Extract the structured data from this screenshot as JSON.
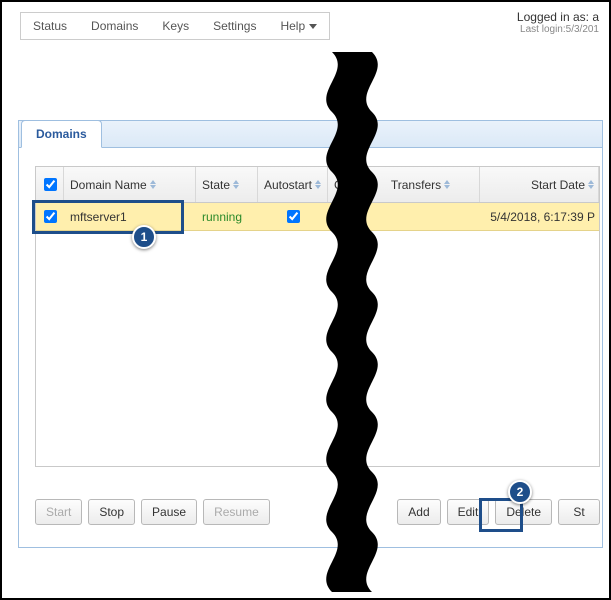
{
  "menu": {
    "status": "Status",
    "domains": "Domains",
    "keys": "Keys",
    "settings": "Settings",
    "help": "Help"
  },
  "login": {
    "logged_in": "Logged in as: a",
    "last": "Last login:5/3/201"
  },
  "tab": {
    "domains": "Domains"
  },
  "columns": {
    "name": "Domain Name",
    "state": "State",
    "autostart": "Autostart",
    "cut": "C",
    "transfers": "Transfers",
    "start_date": "Start Date"
  },
  "rows": [
    {
      "name": "mftserver1",
      "state": "running",
      "autostart": true,
      "start_date": "5/4/2018, 6:17:39 P"
    }
  ],
  "buttons": {
    "start": "Start",
    "stop": "Stop",
    "pause": "Pause",
    "resume": "Resume",
    "add": "Add",
    "edit": "Edit",
    "delete": "Delete",
    "st": "St"
  },
  "callouts": {
    "one": "1",
    "two": "2"
  }
}
